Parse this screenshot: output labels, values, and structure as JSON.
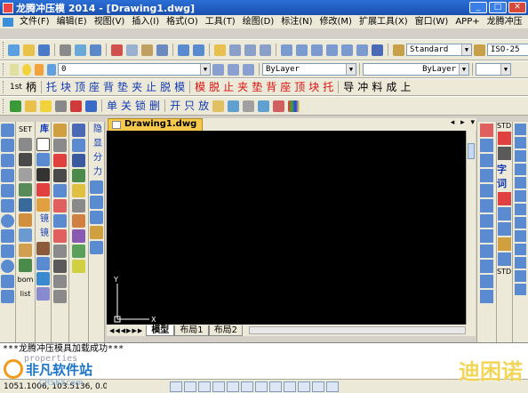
{
  "window": {
    "title": "龙腾冲压模 2014 - [Drawing1.dwg]"
  },
  "menu": {
    "items": [
      "文件(F)",
      "编辑(E)",
      "视图(V)",
      "插入(I)",
      "格式(O)",
      "工具(T)",
      "绘图(D)",
      "标注(N)",
      "修改(M)",
      "扩展工具(X)",
      "窗口(W)",
      "APP+",
      "龙腾冲压"
    ]
  },
  "toolbar_standard": {
    "text_style": "Standard",
    "dim_style": "ISO-25"
  },
  "toolbar_layers": {
    "layer": "0",
    "color": "ByLayer",
    "linetype": "ByLayer"
  },
  "toolbar_die": {
    "items": [
      {
        "text": "1st",
        "color": "black"
      },
      {
        "text": "柄",
        "color": "black"
      },
      {
        "text": "托",
        "color": "blue"
      },
      {
        "text": "块",
        "color": "blue"
      },
      {
        "text": "顶",
        "color": "blue"
      },
      {
        "text": "座",
        "color": "blue"
      },
      {
        "text": "背",
        "color": "blue"
      },
      {
        "text": "垫",
        "color": "blue"
      },
      {
        "text": "夹",
        "color": "blue"
      },
      {
        "text": "止",
        "color": "blue"
      },
      {
        "text": "脱",
        "color": "blue"
      },
      {
        "text": "模",
        "color": "blue"
      },
      {
        "text": "模",
        "color": "red"
      },
      {
        "text": "脱",
        "color": "red"
      },
      {
        "text": "止",
        "color": "red"
      },
      {
        "text": "夹",
        "color": "red"
      },
      {
        "text": "垫",
        "color": "red"
      },
      {
        "text": "背",
        "color": "red"
      },
      {
        "text": "座",
        "color": "red"
      },
      {
        "text": "顶",
        "color": "red"
      },
      {
        "text": "块",
        "color": "red"
      },
      {
        "text": "托",
        "color": "red"
      },
      {
        "text": "导",
        "color": "black"
      },
      {
        "text": "冲",
        "color": "black"
      },
      {
        "text": "料",
        "color": "black"
      },
      {
        "text": "成",
        "color": "black"
      },
      {
        "text": "上",
        "color": "black"
      }
    ]
  },
  "toolbar_misc": {
    "labels": [
      "单",
      "关",
      "锁",
      "删",
      "开",
      "只",
      "放"
    ]
  },
  "left_panel": {
    "col2_labels": [
      "SET",
      "bom",
      "list"
    ],
    "col3_labels": [
      "库",
      "镜",
      "镜"
    ],
    "col5_labels": [
      "隐",
      "显",
      "分",
      "力"
    ]
  },
  "right_panel": {
    "labels": [
      "STD",
      "字",
      "词",
      "STD"
    ]
  },
  "document": {
    "tab": "Drawing1.dwg"
  },
  "ucs": {
    "x_label": "X",
    "y_label": "Y"
  },
  "layout_tabs": [
    "模型",
    "布局1",
    "布局2"
  ],
  "command": {
    "line1": "***龙腾冲压模具加载成功***",
    "line2": "properties"
  },
  "status": {
    "coords": "1051.1006, 103.5136, 0.0000"
  },
  "watermark": {
    "left_brand": "非凡软件站",
    "left_sub": "CRSKY.com",
    "right_brand": "迪困诺"
  }
}
